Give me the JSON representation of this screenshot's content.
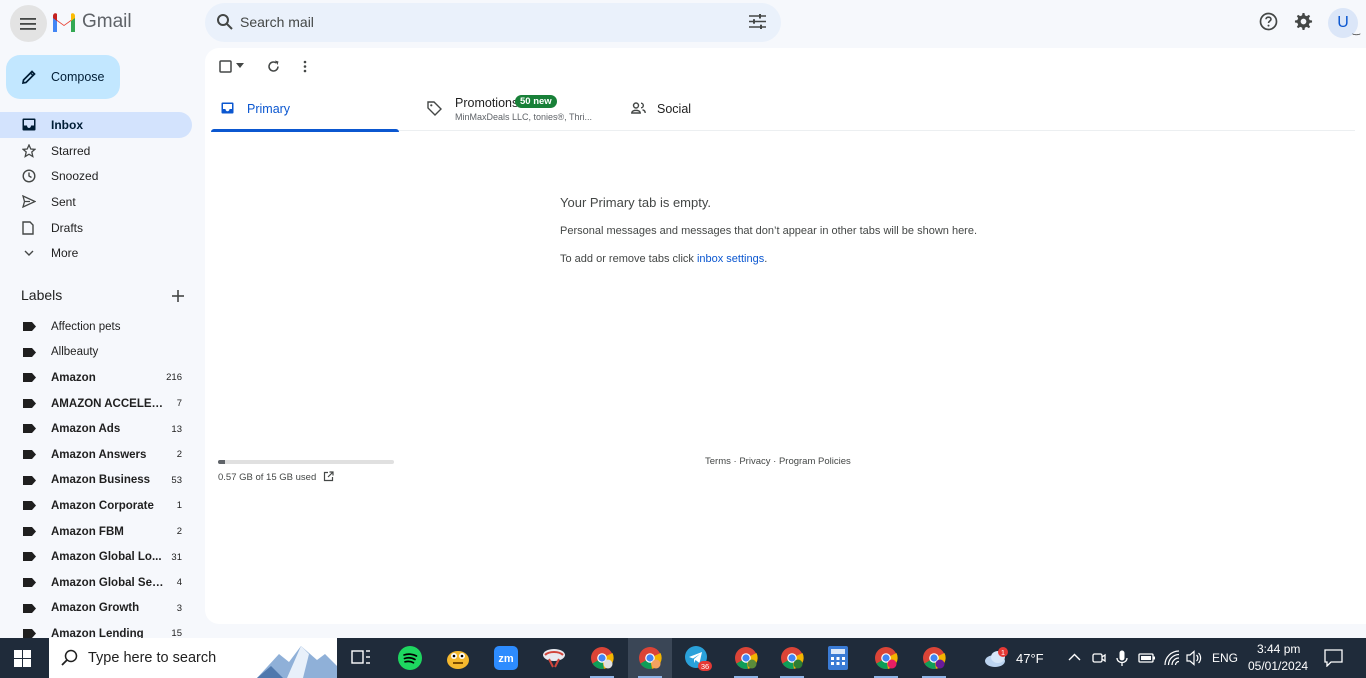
{
  "app": {
    "name": "Gmail"
  },
  "search": {
    "placeholder": "Search mail"
  },
  "compose": {
    "label": "Compose"
  },
  "nav": [
    {
      "label": "Inbox",
      "icon": "inbox-icon",
      "active": true
    },
    {
      "label": "Starred",
      "icon": "star-icon"
    },
    {
      "label": "Snoozed",
      "icon": "clock-icon"
    },
    {
      "label": "Sent",
      "icon": "send-icon"
    },
    {
      "label": "Drafts",
      "icon": "draft-icon"
    },
    {
      "label": "More",
      "icon": "chevron-down-icon"
    }
  ],
  "labels": {
    "header": "Labels",
    "items": [
      {
        "name": "Affection pets",
        "count": "",
        "bold": false
      },
      {
        "name": "Allbeauty",
        "count": "",
        "bold": false
      },
      {
        "name": "Amazon",
        "count": "216",
        "bold": true
      },
      {
        "name": "AMAZON ACCELER...",
        "count": "7",
        "bold": true
      },
      {
        "name": "Amazon Ads",
        "count": "13",
        "bold": true
      },
      {
        "name": "Amazon Answers",
        "count": "2",
        "bold": true
      },
      {
        "name": "Amazon Business",
        "count": "53",
        "bold": true
      },
      {
        "name": "Amazon Corporate",
        "count": "1",
        "bold": true
      },
      {
        "name": "Amazon FBM",
        "count": "2",
        "bold": true
      },
      {
        "name": "Amazon Global Lo...",
        "count": "31",
        "bold": true
      },
      {
        "name": "Amazon Global Sell...",
        "count": "4",
        "bold": true
      },
      {
        "name": "Amazon Growth",
        "count": "3",
        "bold": true
      },
      {
        "name": "Amazon Lending",
        "count": "15",
        "bold": true
      }
    ]
  },
  "tabs": {
    "primary": "Primary",
    "promotions": {
      "label": "Promotions",
      "badge": "50 new",
      "senders": "MinMaxDeals LLC, tonies®, Thri..."
    },
    "social": "Social"
  },
  "empty": {
    "title": "Your Primary tab is empty.",
    "line1": "Personal messages and messages that don’t appear in other tabs will be shown here.",
    "line2_prefix": "To add or remove tabs click ",
    "line2_link": "inbox settings",
    "line2_suffix": "."
  },
  "storage": {
    "text": "0.57 GB of 15 GB used",
    "fraction": 0.038
  },
  "footer": {
    "terms": "Terms",
    "privacy": "Privacy",
    "policies": "Program Policies"
  },
  "account": {
    "initial": "U"
  },
  "taskbar": {
    "search_text": "Type here to search",
    "weather": "47°F",
    "weather_badge": "1",
    "lang": "ENG",
    "time": "3:44 pm",
    "date": "05/01/2024",
    "telegram_badge": "36"
  }
}
